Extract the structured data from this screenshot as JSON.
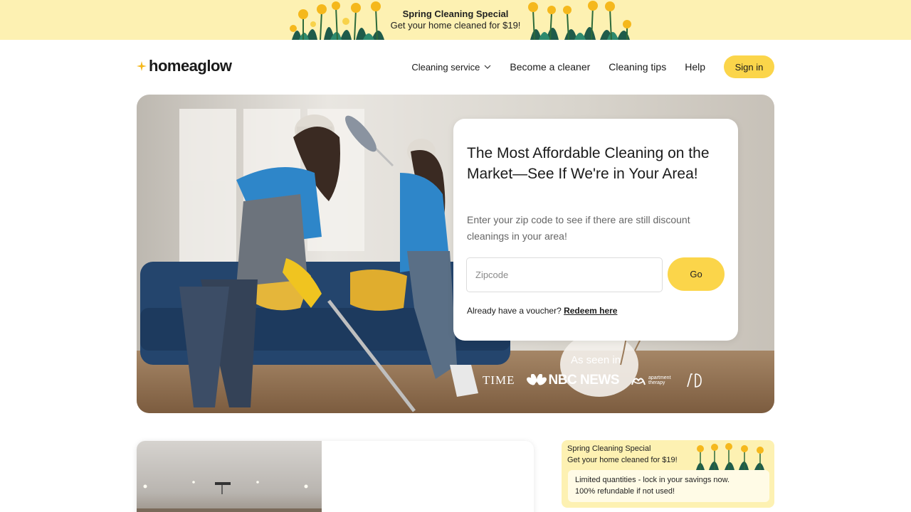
{
  "promo": {
    "title": "Spring Cleaning Special",
    "subtitle": "Get your home cleaned for $19!"
  },
  "header": {
    "logo_text": "homeaglow",
    "nav": [
      "Cleaning service",
      "Become a cleaner",
      "Cleaning tips",
      "Help"
    ],
    "signin_label": "Sign in"
  },
  "hero": {
    "heading": "The Most Affordable Cleaning on the Market—See If We're in Your Area!",
    "description": "Enter your zip code to see if there are still discount cleanings in your area!",
    "zip_placeholder": "Zipcode",
    "zip_value": "",
    "go_label": "Go",
    "voucher_text": "Already have a voucher?",
    "voucher_link": "Redeem here",
    "as_seen_in": "As seen in",
    "press": {
      "time": "TIME",
      "nbc": "NBC NEWS",
      "at_line1": "apartment",
      "at_line2": "therapy"
    }
  },
  "special_card": {
    "title": "Spring Cleaning Special",
    "subtitle": "Get your home cleaned for $19!",
    "line1": "Limited quantities - lock in your savings now.",
    "line2": "100% refundable if not used!"
  },
  "colors": {
    "accent": "#fbd54a",
    "banner_bg": "#fdf1b2",
    "text": "#1a1a1a"
  }
}
